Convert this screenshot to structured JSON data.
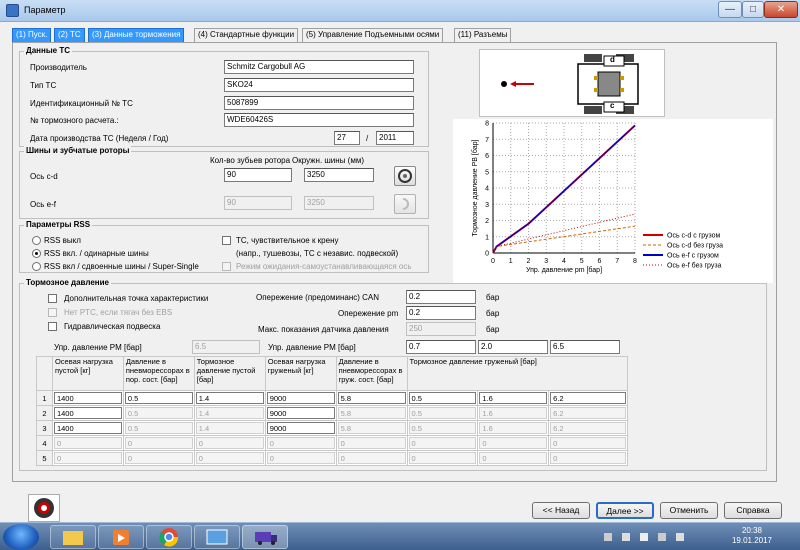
{
  "window": {
    "title": "Параметр",
    "minimize": "—",
    "maximize": "□",
    "close": "✕"
  },
  "tabs": [
    "(1) Пуск.",
    "(2) ТС",
    "(3) Данные торможения",
    "(4) Стандартные функции",
    "(5) Управление Подъемными осями",
    "(11) Разъемы"
  ],
  "vehicle": {
    "title": "Данные ТС",
    "manufacturer_label": "Производитель",
    "manufacturer": "Schmitz Cargobull AG",
    "type_label": "Тип ТС",
    "type": "SKO24",
    "vin_label": "Идентификационный № ТС",
    "vin": "5087899",
    "calc_label": "№ тормозного расчета.:",
    "calc": "WDE60426S",
    "date_label": "Дата производства ТС (Неделя / Год)",
    "week": "27",
    "sep": "/",
    "year": "2011"
  },
  "tires": {
    "title": "Шины и зубчатые роторы",
    "teeth_header": "Кол-во зубьев ротора",
    "circ_header": "Окружн. шины (мм)",
    "axle_cd_label": "Ось c-d",
    "cd_teeth": "90",
    "cd_circ": "3250",
    "axle_ef_label": "Ось e-f",
    "ef_teeth": "90",
    "ef_circ": "3250"
  },
  "rss": {
    "title": "Параметры RSS",
    "opt_off": "RSS выкл",
    "opt_single": "RSS вкл. / одинарные шины",
    "opt_twin": "RSS вкл / сдвоенные шины / Super-Single",
    "roll_label": "ТС, чувствительное к крену",
    "roll_note": "(напр., тушевозы, ТС с независ. подвеской)",
    "selfsteer_label": "Режим ожидания-самоустанавливающаяся ось"
  },
  "diagram": {
    "axle_c": "c",
    "axle_d": "d"
  },
  "chart_data": {
    "type": "line",
    "xlabel": "Упр. давление pm [бар]",
    "ylabel": "Тормозное давление РВ [бар]",
    "xlim": [
      0,
      8
    ],
    "ylim": [
      0,
      8
    ],
    "xticks": [
      "0",
      "1",
      "2",
      "3",
      "4",
      "5",
      "6",
      "7",
      "8"
    ],
    "yticks": [
      "0",
      "1",
      "2",
      "3",
      "4",
      "5",
      "6",
      "7",
      "8"
    ],
    "grid": true,
    "legend_position": "right",
    "series": [
      {
        "name": "Ось c-d с грузом",
        "color": "#cc0000",
        "style": "solid",
        "x": [
          0,
          0.2,
          2,
          8
        ],
        "y": [
          0,
          0.4,
          1.8,
          7.85
        ]
      },
      {
        "name": "Ось c-d без груза",
        "color": "#cc6600",
        "style": "dashed",
        "x": [
          0,
          0.2,
          8
        ],
        "y": [
          0,
          0.4,
          1.65
        ]
      },
      {
        "name": "Ось e-f с грузом",
        "color": "#0000cc",
        "style": "solid",
        "x": [
          0,
          0.2,
          2,
          8
        ],
        "y": [
          0,
          0.4,
          1.8,
          7.85
        ]
      },
      {
        "name": "Ось e-f без груза",
        "color": "#cc0000",
        "style": "dotted",
        "x": [
          0,
          0.2,
          8
        ],
        "y": [
          0,
          0.4,
          2.4
        ]
      }
    ]
  },
  "brake": {
    "title": "Тормозное давление",
    "extra_point": "Дополнительная точка характеристики",
    "no_ptc": "Нет PTC, если тягач без EBS",
    "hydraulic": "Гидравлическая подвеска",
    "advance_can_label": "Опережение  (предоминанс) CAN",
    "advance_can": "0.2",
    "unit_bar": "бар",
    "advance_pm_label": "Опережение pm",
    "advance_pm": "0.2",
    "max_sensor_label": "Макс. показания датчика давления",
    "max_sensor": "250",
    "pm_label_left": "Упр. давление PM [бар]",
    "pm_left": "6.5",
    "pm_label_right": "Упр. давление PM [бар]",
    "pm_right": [
      "0.7",
      "2.0",
      "6.5"
    ],
    "headers": [
      "Осевая нагрузка пустой [кг]",
      "Давление в пневморессорах в пор. сост. [бар]",
      "Тормозное давление пустой [бар]",
      "Осевая нагрузка груженый [кг]",
      "Давление в пневморессорах в груж. сост. [бар]",
      "Тормозное давление груженый [бар]"
    ],
    "rows": [
      {
        "n": "1",
        "v": [
          "1400",
          "0.5",
          "1.4",
          "9000",
          "5.8",
          "0.5",
          "1.6",
          "6.2"
        ],
        "en": true
      },
      {
        "n": "2",
        "v": [
          "1400",
          "0.5",
          "1.4",
          "9000",
          "5.8",
          "0.5",
          "1.6",
          "6.2"
        ],
        "en": false
      },
      {
        "n": "3",
        "v": [
          "1400",
          "0.5",
          "1.4",
          "9000",
          "5.8",
          "0.5",
          "1.6",
          "6.2"
        ],
        "en": false
      },
      {
        "n": "4",
        "v": [
          "0",
          "0",
          "0",
          "0",
          "0",
          "0",
          "0",
          "0"
        ],
        "en": false
      },
      {
        "n": "5",
        "v": [
          "0",
          "0",
          "0",
          "0",
          "0",
          "0",
          "0",
          "0"
        ],
        "en": false
      }
    ]
  },
  "buttons": {
    "back": "<< Назад",
    "next": "Далее >>",
    "cancel": "Отменить",
    "help": "Справка"
  },
  "taskbar": {
    "time": "20:38",
    "date": "19.01.2017"
  }
}
